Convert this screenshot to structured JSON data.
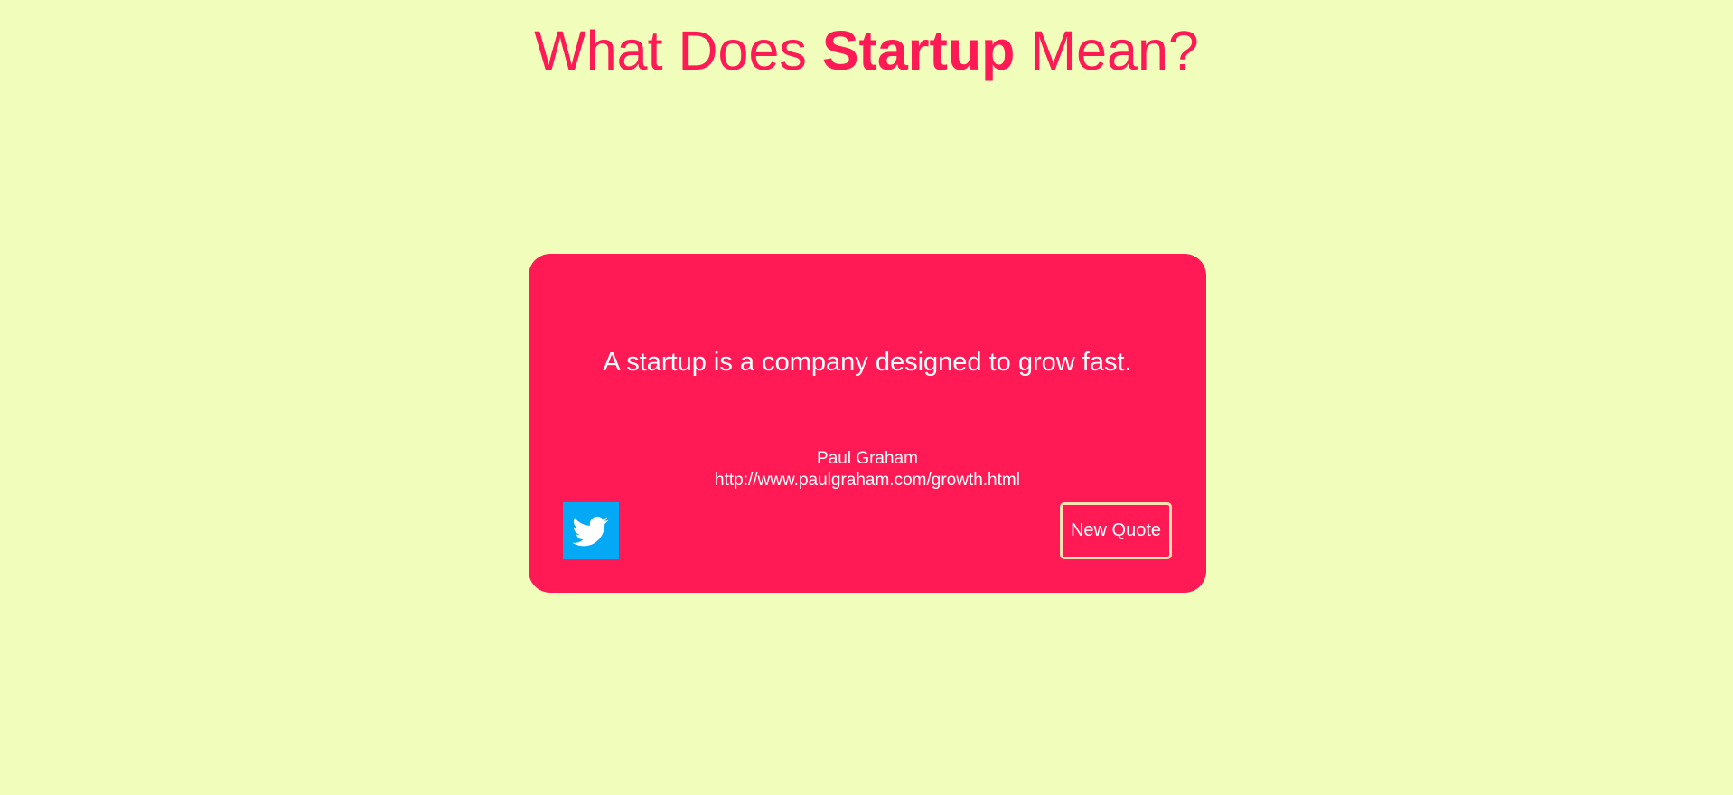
{
  "header": {
    "title_part1": "What Does ",
    "title_strong": "Startup",
    "title_part2": " Mean?"
  },
  "quote": {
    "text": "A startup is a company designed to grow fast.",
    "author": "Paul Graham",
    "source": "http://www.paulgraham.com/growth.html"
  },
  "actions": {
    "tweet_icon": "twitter-bird-icon",
    "new_quote_label": "New Quote"
  },
  "colors": {
    "background": "#f1fdba",
    "accent": "#ff1a55",
    "twitter_blue": "#03a9f4",
    "button_border": "#f8e3b0"
  }
}
